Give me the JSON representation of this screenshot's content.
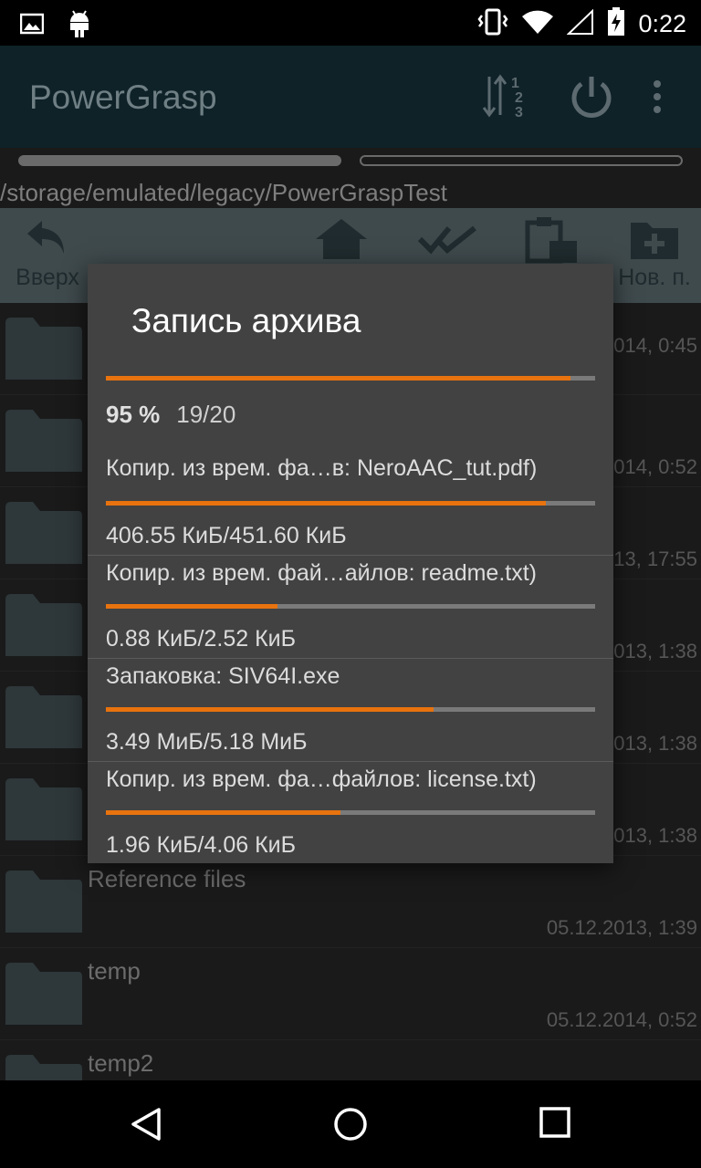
{
  "status_bar": {
    "time": "0:22",
    "icons": [
      "image-icon",
      "android-icon",
      "vibrate-icon",
      "wifi-icon",
      "signal-icon",
      "battery-charging-icon"
    ]
  },
  "action_bar": {
    "title": "PowerGrasp",
    "icons": [
      "sort-icon",
      "power-icon",
      "overflow-menu-icon"
    ]
  },
  "path": "/storage/emulated/legacy/PowerGraspTest",
  "toolbar": {
    "up_label": "Вверх",
    "new_label": "Нов. п.",
    "icons": [
      "back-up-icon",
      "home-icon",
      "select-all-icon",
      "paste-icon",
      "new-folder-icon"
    ]
  },
  "files": [
    {
      "name": "",
      "date": "014, 0:45"
    },
    {
      "name": "",
      "date": "014, 0:52"
    },
    {
      "name": "",
      "date": "13, 17:55"
    },
    {
      "name": "",
      "date": "013, 1:38"
    },
    {
      "name": "",
      "date": "013, 1:38"
    },
    {
      "name": "",
      "date": "013, 1:38"
    },
    {
      "name": "Reference files",
      "date": "05.12.2013, 1:39"
    },
    {
      "name": "temp",
      "date": "05.12.2014, 0:52"
    },
    {
      "name": "temp2",
      "date": ""
    }
  ],
  "dialog": {
    "title": "Запись архива",
    "total_progress": 0.95,
    "percent": "95 %",
    "count": "19/20",
    "colors": {
      "accent": "#e8730e",
      "track": "#7a7a7a"
    },
    "items": [
      {
        "name": "Копир. из врем. фа…в: NeroAAC_tut.pdf)",
        "size": "406.55 КиБ/451.60 КиБ",
        "progress": 0.9
      },
      {
        "name": "Копир. из врем. фай…айлов: readme.txt)",
        "size": "0.88 КиБ/2.52 КиБ",
        "progress": 0.35
      },
      {
        "name": "Запаковка: SIV64I.exe",
        "size": "3.49 МиБ/5.18 МиБ",
        "progress": 0.67
      },
      {
        "name": "Копир. из врем. фа…файлов: license.txt)",
        "size": "1.96 КиБ/4.06 КиБ",
        "progress": 0.48
      }
    ]
  },
  "nav_bar": {
    "icons": [
      "back-icon",
      "home-circle-icon",
      "recents-icon"
    ]
  }
}
